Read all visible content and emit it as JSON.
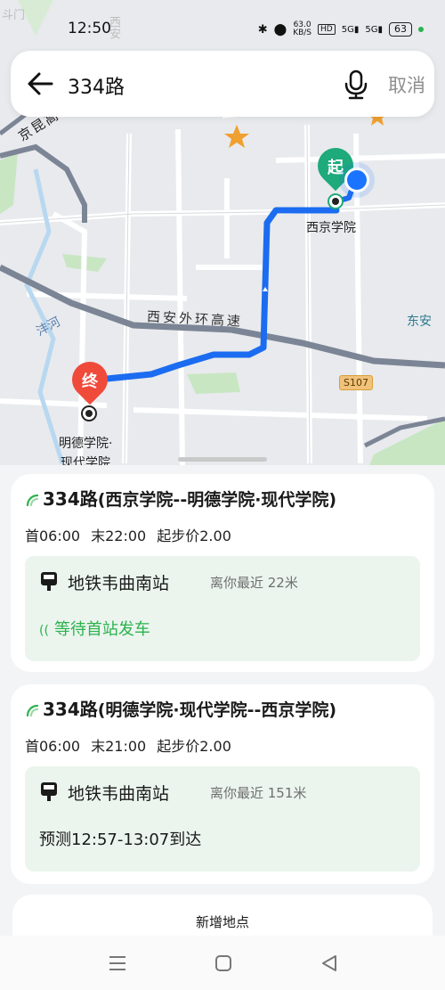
{
  "status": {
    "time": "12:50",
    "net_speed": "63.0",
    "net_unit": "KB/S",
    "hd": "HD",
    "sig1": "5G",
    "sig2": "5G",
    "battery": "63"
  },
  "search": {
    "query": "334路",
    "cancel": "取消"
  },
  "map": {
    "labels": {
      "top_left": "斗门",
      "xian_vertical": "西安",
      "jingkun": "京昆高",
      "start_stop": "西京学院",
      "ring_road": "西安外环高速",
      "river": "沣河",
      "dongan": "东安",
      "s107": "S107",
      "end_stop_line1": "明德学院·",
      "end_stop_line2": "现代学院"
    },
    "start_pin": "起",
    "end_pin": "终"
  },
  "routes": [
    {
      "number": "334路",
      "direction": "(西京学院--明德学院·现代学院)",
      "first": "首06:00",
      "last": "末22:00",
      "fare": "起步价2.00",
      "stop": "地铁韦曲南站",
      "distance": "离你最近 22米",
      "status": "等待首站发车"
    },
    {
      "number": "334路",
      "direction": "(明德学院·现代学院--西京学院)",
      "first": "首06:00",
      "last": "末21:00",
      "fare": "起步价2.00",
      "stop": "地铁韦曲南站",
      "distance": "离你最近 151米",
      "status": "预测12:57-13:07到达"
    }
  ],
  "add_location": "新增地点",
  "colors": {
    "route_line": "#1b6cf0",
    "start_pin": "#1eaa7a",
    "end_pin": "#f04a3a",
    "realtime_green": "#2bb24c"
  },
  "icons": [
    "back-arrow-icon",
    "microphone-icon",
    "bus-stop-icon",
    "realtime-signal-icon",
    "menu-icon",
    "home-icon",
    "back-triangle-icon"
  ]
}
